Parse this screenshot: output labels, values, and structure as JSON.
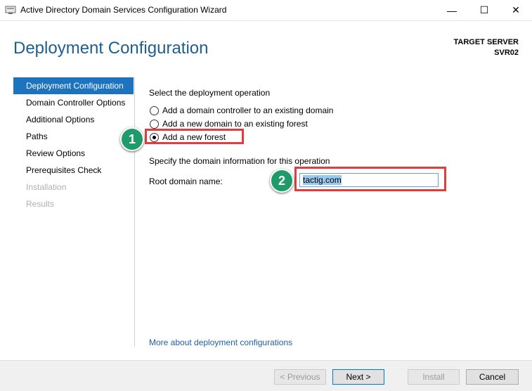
{
  "window": {
    "title": "Active Directory Domain Services Configuration Wizard",
    "minimize": "—",
    "maximize": "☐",
    "close": "✕"
  },
  "header": {
    "page_title": "Deployment Configuration",
    "target_label": "TARGET SERVER",
    "target_server": "SVR02"
  },
  "nav": {
    "items": [
      {
        "label": "Deployment Configuration",
        "state": "active"
      },
      {
        "label": "Domain Controller Options",
        "state": "enabled"
      },
      {
        "label": "Additional Options",
        "state": "enabled"
      },
      {
        "label": "Paths",
        "state": "enabled"
      },
      {
        "label": "Review Options",
        "state": "enabled"
      },
      {
        "label": "Prerequisites Check",
        "state": "enabled"
      },
      {
        "label": "Installation",
        "state": "disabled"
      },
      {
        "label": "Results",
        "state": "disabled"
      }
    ]
  },
  "content": {
    "operation_heading": "Select the deployment operation",
    "options": [
      {
        "label": "Add a domain controller to an existing domain",
        "checked": false
      },
      {
        "label": "Add a new domain to an existing forest",
        "checked": false
      },
      {
        "label": "Add a new forest",
        "checked": true
      }
    ],
    "domain_heading": "Specify the domain information for this operation",
    "root_domain_label": "Root domain name:",
    "root_domain_value": "tactig.com",
    "more_link": "More about deployment configurations"
  },
  "annotations": {
    "badge1": "1",
    "badge2": "2",
    "badge_color": "#1e9b68",
    "highlight_color": "#e23c3c"
  },
  "footer": {
    "previous": "< Previous",
    "next": "Next >",
    "install": "Install",
    "cancel": "Cancel"
  },
  "colors": {
    "accent": "#1e73be",
    "title": "#1f5f8e",
    "link": "#1f5fa8"
  },
  "icons": {
    "app": "server-wizard-icon"
  }
}
